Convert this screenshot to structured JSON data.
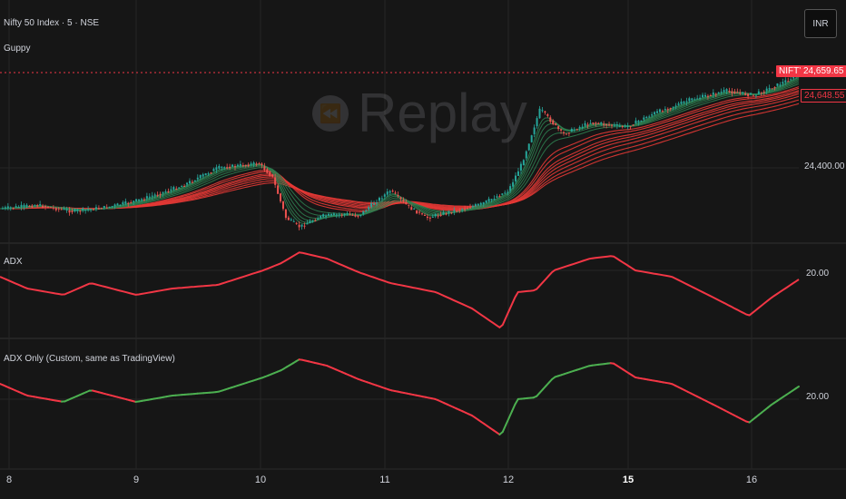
{
  "header": {
    "symbol": "Nifty 50 Index · 5 · NSE",
    "indicator": "Guppy",
    "currency": "INR"
  },
  "watermark": {
    "text": "Replay",
    "icon": "rewind-icon"
  },
  "price_axis": {
    "ticker": "NIFTY",
    "last": "24,659.65",
    "prev": "24,648.55",
    "tick": "24,400.00"
  },
  "colors": {
    "bull": "#26a69a",
    "bear": "#ef5350",
    "adx_red": "#f23645",
    "adx_green": "#4caf50",
    "grid": "#262626",
    "bg": "#161616"
  },
  "panes": {
    "adx1": {
      "title": "ADX",
      "level": "20.00"
    },
    "adx2": {
      "title": "ADX Only (Custom, same as TradingView)",
      "level": "20.00"
    }
  },
  "chart_data": [
    {
      "type": "line",
      "title": "Nifty 50 Index · 5 · NSE",
      "x": [
        "8",
        "9",
        "10",
        "11",
        "12",
        "15",
        "16"
      ],
      "y_ticks": [
        24400
      ],
      "series": [
        {
          "name": "NIFTY",
          "values": [
            24320,
            24330,
            24360,
            24420,
            24250,
            24330,
            24350,
            24480,
            24580,
            24650
          ]
        }
      ]
    },
    {
      "type": "line",
      "title": "ADX",
      "x": [
        "8",
        "9",
        "10",
        "11",
        "12",
        "15",
        "16"
      ],
      "series": [
        {
          "values": [
            22,
            17,
            19,
            24,
            18,
            8,
            26,
            28,
            17,
            11,
            20
          ]
        }
      ]
    },
    {
      "type": "line",
      "title": "ADX Only (Custom, same as TradingView)",
      "x": [
        "8",
        "9",
        "10",
        "11",
        "12",
        "15",
        "16"
      ],
      "series": [
        {
          "values": [
            22,
            17,
            19,
            24,
            18,
            8,
            26,
            28,
            17,
            11,
            20
          ]
        }
      ]
    }
  ],
  "x_axis": {
    "labels": [
      "8",
      "9",
      "10",
      "11",
      "12",
      "15",
      "16"
    ]
  }
}
